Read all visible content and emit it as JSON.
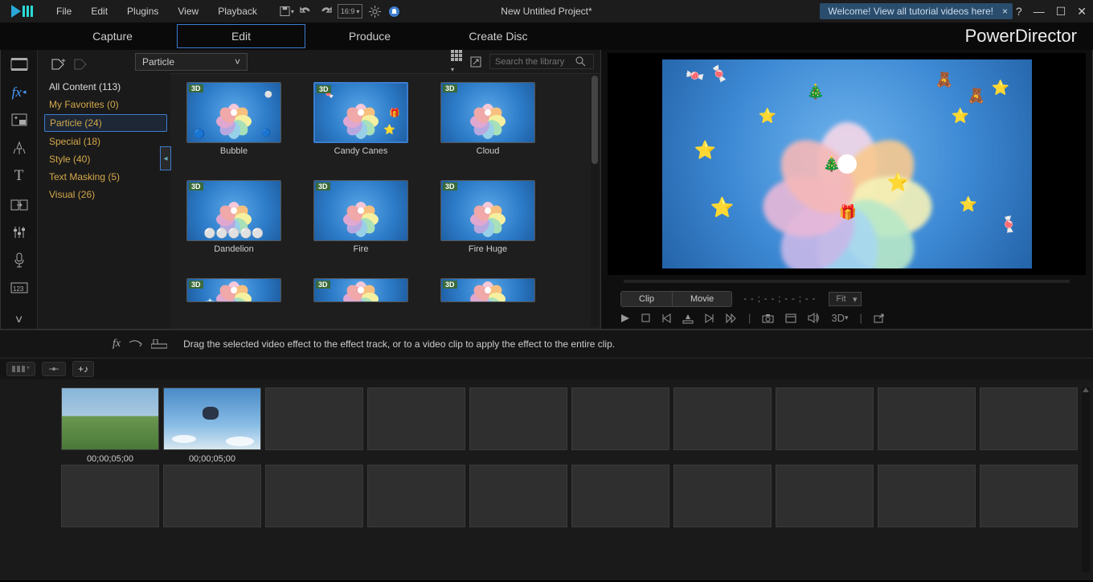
{
  "menubar": {
    "items": [
      "File",
      "Edit",
      "Plugins",
      "View",
      "Playback"
    ],
    "title": "New Untitled Project*",
    "welcome": "Welcome! View all tutorial videos here!",
    "aspect": "16:9"
  },
  "tabs": {
    "items": [
      "Capture",
      "Edit",
      "Produce",
      "Create Disc"
    ],
    "activeIndex": 1,
    "brand": "PowerDirector"
  },
  "library": {
    "dropdown": "Particle",
    "search_placeholder": "Search the library",
    "categories": [
      {
        "label": "All Content (113)",
        "type": "all"
      },
      {
        "label": "My Favorites  (0)",
        "type": "fav"
      },
      {
        "label": "Particle  (24)",
        "type": "sel"
      },
      {
        "label": "Special  (18)",
        "type": ""
      },
      {
        "label": "Style  (40)",
        "type": ""
      },
      {
        "label": "Text Masking  (5)",
        "type": ""
      },
      {
        "label": "Visual  (26)",
        "type": ""
      }
    ],
    "thumbs": [
      {
        "label": "Bubble",
        "selected": false
      },
      {
        "label": "Candy Canes",
        "selected": true
      },
      {
        "label": "Cloud",
        "selected": false
      },
      {
        "label": "Dandelion",
        "selected": false
      },
      {
        "label": "Fire",
        "selected": false
      },
      {
        "label": "Fire Huge",
        "selected": false
      },
      {
        "label": "",
        "selected": false
      },
      {
        "label": "",
        "selected": false
      },
      {
        "label": "",
        "selected": false
      }
    ]
  },
  "preview": {
    "seg": [
      "Clip",
      "Movie"
    ],
    "timecode": "- - ; - - ; - - ; - -",
    "fit": "Fit",
    "threeD": "3D"
  },
  "hint": {
    "text": "Drag the selected video effect to the effect track, or to a video clip to apply the effect to the entire clip."
  },
  "timeline": {
    "clips": [
      {
        "time": "00;00;05;00",
        "type": "landscape"
      },
      {
        "time": "00;00;05;00",
        "type": "skydive"
      }
    ]
  }
}
